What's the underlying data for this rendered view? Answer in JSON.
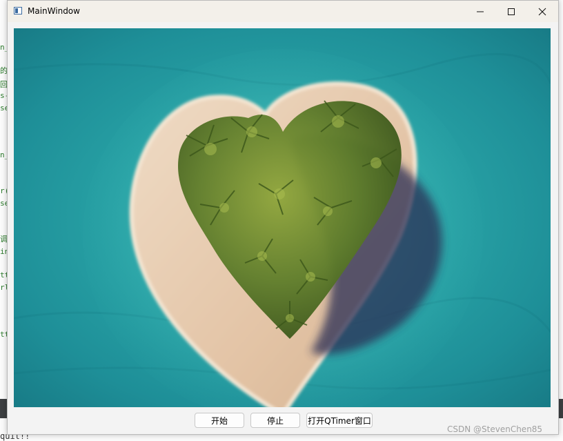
{
  "window": {
    "title": "MainWindow",
    "minimize_glyph": "—",
    "maximize_glyph": "☐",
    "close_glyph": "✕"
  },
  "image": {
    "subject": "heart-shaped tropical island"
  },
  "buttons": {
    "start_label": "开始",
    "stop_label": "停止",
    "open_timer_label": "打开QTimer窗口"
  },
  "watermark": "CSDN @StevenChen85",
  "background_code": {
    "bottom_line": "quit!!",
    "left_fragments": [
      "n_",
      "的",
      "回",
      "s-",
      "se",
      "n_",
      "r(",
      "se",
      "调",
      "in",
      "tt",
      "rl",
      "tt"
    ]
  },
  "colors": {
    "water": "#2aa6a8",
    "sand": "#e6c9ab",
    "palm": "#5e7d2a",
    "shadow": "#2b2f55"
  }
}
